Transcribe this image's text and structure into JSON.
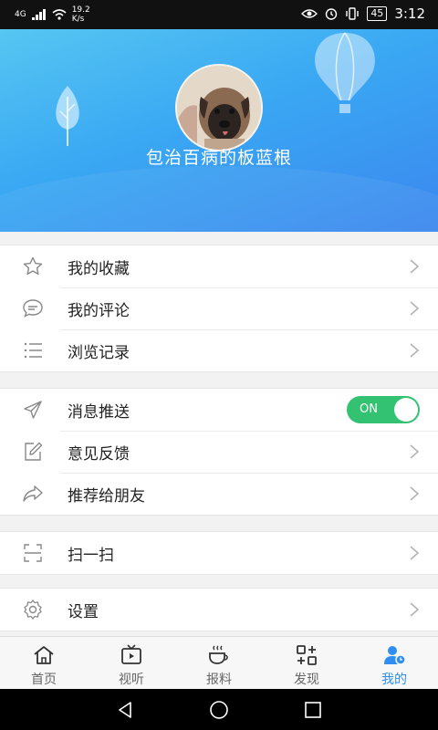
{
  "status_bar": {
    "signal": "4G",
    "speed_value": "19.2",
    "speed_unit": "K/s",
    "battery": "45",
    "time": "3:12"
  },
  "profile": {
    "username": "包治百病的板蓝根"
  },
  "groups": [
    {
      "items": [
        {
          "label": "我的收藏",
          "icon": "star-icon"
        },
        {
          "label": "我的评论",
          "icon": "comment-icon"
        },
        {
          "label": "浏览记录",
          "icon": "list-icon"
        }
      ]
    },
    {
      "items": [
        {
          "label": "消息推送",
          "icon": "send-icon",
          "toggle": "ON"
        },
        {
          "label": "意见反馈",
          "icon": "edit-icon"
        },
        {
          "label": "推荐给朋友",
          "icon": "share-icon"
        }
      ]
    },
    {
      "items": [
        {
          "label": "扫一扫",
          "icon": "scan-icon"
        }
      ]
    },
    {
      "items": [
        {
          "label": "设置",
          "icon": "gear-icon"
        }
      ]
    }
  ],
  "tabs": [
    {
      "label": "首页",
      "icon": "home-icon",
      "active": false
    },
    {
      "label": "视听",
      "icon": "tv-icon",
      "active": false
    },
    {
      "label": "报料",
      "icon": "coffee-icon",
      "active": false
    },
    {
      "label": "发现",
      "icon": "discover-icon",
      "active": false
    },
    {
      "label": "我的",
      "icon": "user-icon",
      "active": true
    }
  ],
  "colors": {
    "accent": "#2f8ef0",
    "toggle_on": "#33c271",
    "header_start": "#56c6f2",
    "header_end": "#3b87ee"
  }
}
